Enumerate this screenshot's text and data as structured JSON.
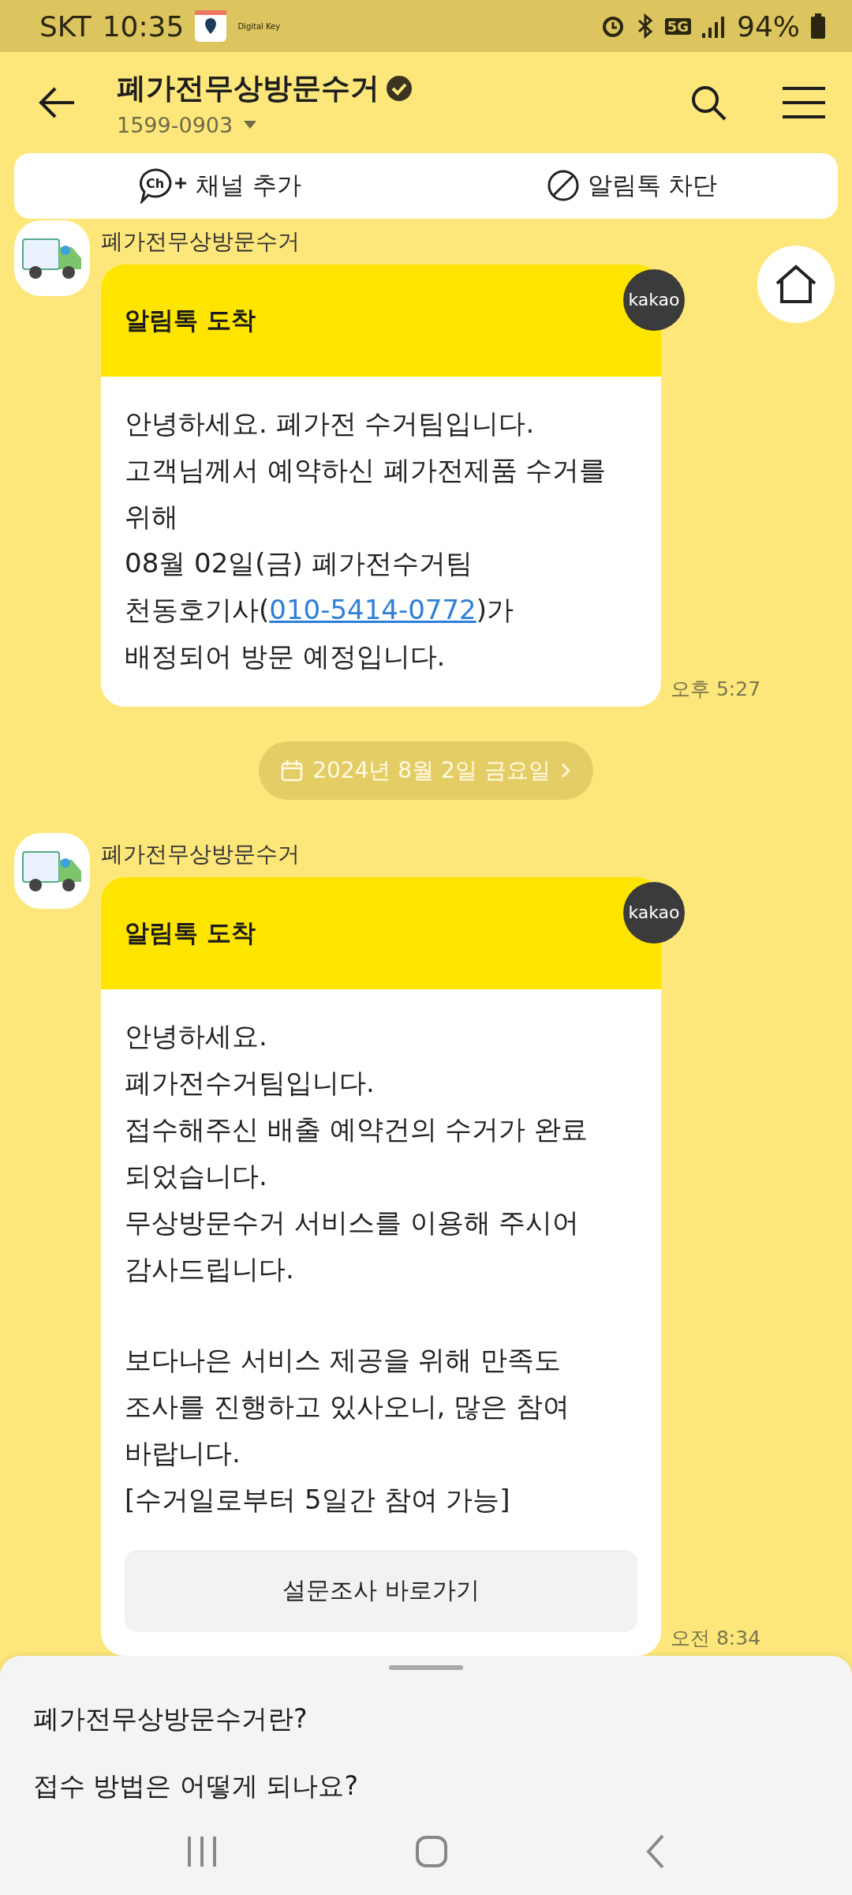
{
  "status_bar": {
    "carrier": "SKT",
    "time": "10:35",
    "notification_label": "Digital Key",
    "network": "5G",
    "battery": "94%"
  },
  "header": {
    "title": "폐가전무상방문수거",
    "phone": "1599-0903"
  },
  "actions": [
    {
      "kind": "add",
      "label": "채널 추가",
      "icon_text": "Ch"
    },
    {
      "kind": "block",
      "label": "알림톡 차단"
    }
  ],
  "messages": [
    {
      "sender": "폐가전무상방문수거",
      "badge": "kakao",
      "header": "알림톡 도착",
      "paragraphs": [
        [
          "안녕하세요. 폐가전 수거팀입니다.",
          "고객님께서 예약하신 폐가전제품 수거를",
          "위해",
          "08월 02일(금) 폐가전수거팀",
          {
            "before": "천동호기사(",
            "link": "010-5414-0772",
            "after": ")가"
          },
          "배정되어 방문 예정입니다."
        ]
      ],
      "time": "오후 5:27"
    },
    {
      "date_divider": "2024년 8월 2일 금요일"
    },
    {
      "sender": "폐가전무상방문수거",
      "badge": "kakao",
      "header": "알림톡 도착",
      "paragraphs": [
        [
          "안녕하세요.",
          "폐가전수거팀입니다.",
          "접수해주신 배출 예약건의 수거가 완료",
          "되었습니다.",
          "무상방문수거 서비스를 이용해 주시어",
          "감사드립니다."
        ],
        [
          "보다나은 서비스 제공을 위해 만족도",
          "조사를 진행하고 있사오니, 많은 참여",
          "바랍니다.",
          "[수거일로부터 5일간 참여 가능]"
        ]
      ],
      "button": "설문조사 바로가기",
      "time": "오전 8:34"
    }
  ],
  "faq": [
    "폐가전무상방문수거란?",
    "접수 방법은 어떻게 되나요?"
  ]
}
